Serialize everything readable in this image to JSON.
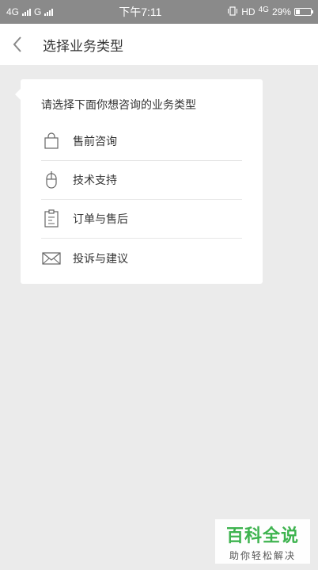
{
  "status_bar": {
    "network_left": "4G",
    "network_mid": "G",
    "time": "下午7:11",
    "network_right": "HD",
    "network_right_sup": "4G",
    "battery_text": "29%",
    "battery_level": 0.29
  },
  "header": {
    "title": "选择业务类型",
    "back_icon": "chevron-left-icon"
  },
  "card": {
    "prompt": "请选择下面你想咨询的业务类型",
    "items": [
      {
        "label": "售前咨询",
        "icon": "shopping-bag-icon"
      },
      {
        "label": "技术支持",
        "icon": "mouse-icon"
      },
      {
        "label": "订单与售后",
        "icon": "clipboard-icon"
      },
      {
        "label": "投诉与建议",
        "icon": "envelope-icon"
      }
    ]
  },
  "watermark": {
    "brand": "百科全说",
    "slogan": "助你轻松解决"
  },
  "colors": {
    "background": "#ebebeb",
    "status_bar": "#8a8a8a",
    "watermark_green": "#3eb34f"
  }
}
